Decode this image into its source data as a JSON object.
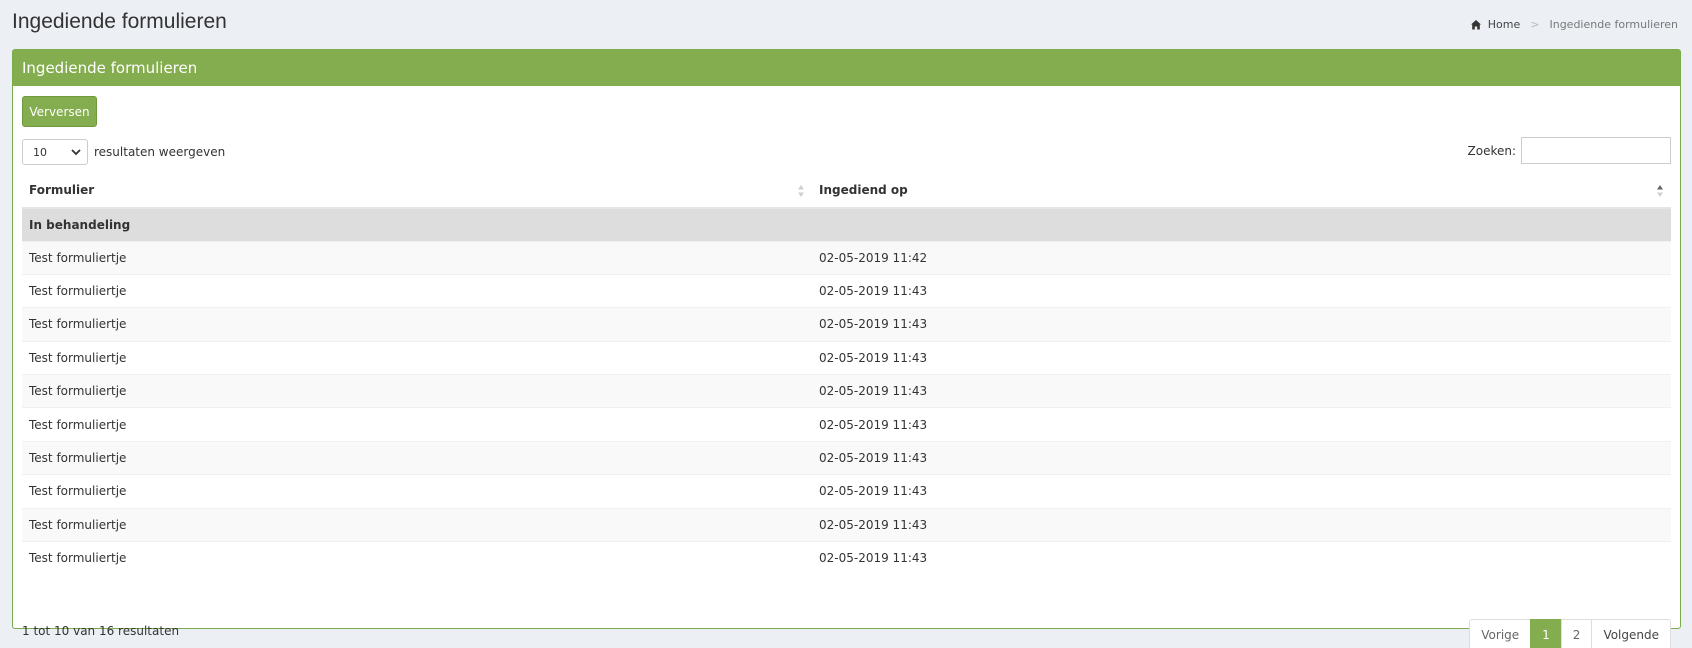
{
  "page": {
    "title": "Ingediende formulieren"
  },
  "breadcrumb": {
    "home_label": "Home",
    "current": "Ingediende formulieren"
  },
  "box": {
    "title": "Ingediende formulieren",
    "refresh_label": "Verversen"
  },
  "controls": {
    "length_value": "10",
    "length_label": "resultaten weergeven",
    "search_label": "Zoeken:",
    "search_value": ""
  },
  "table": {
    "headers": [
      "Formulier",
      "Ingediend op"
    ],
    "group_label": "In behandeling",
    "rows": [
      {
        "form": "Test formuliertje",
        "date": "02-05-2019 11:42"
      },
      {
        "form": "Test formuliertje",
        "date": "02-05-2019 11:43"
      },
      {
        "form": "Test formuliertje",
        "date": "02-05-2019 11:43"
      },
      {
        "form": "Test formuliertje",
        "date": "02-05-2019 11:43"
      },
      {
        "form": "Test formuliertje",
        "date": "02-05-2019 11:43"
      },
      {
        "form": "Test formuliertje",
        "date": "02-05-2019 11:43"
      },
      {
        "form": "Test formuliertje",
        "date": "02-05-2019 11:43"
      },
      {
        "form": "Test formuliertje",
        "date": "02-05-2019 11:43"
      },
      {
        "form": "Test formuliertje",
        "date": "02-05-2019 11:43"
      },
      {
        "form": "Test formuliertje",
        "date": "02-05-2019 11:43"
      }
    ]
  },
  "footer": {
    "info": "1 tot 10 van 16 resultaten",
    "prev_label": "Vorige",
    "pages": [
      "1",
      "2"
    ],
    "active_page": "1",
    "next_label": "Volgende"
  },
  "colors": {
    "accent": "#84ad4f",
    "background": "#ecf0f5"
  }
}
